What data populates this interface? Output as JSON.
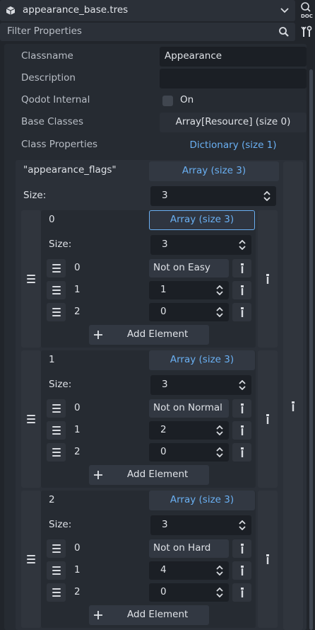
{
  "header": {
    "file_name": "appearance_base.tres",
    "doc_label": "DOC",
    "filter_placeholder": "Filter Properties"
  },
  "properties": [
    {
      "name": "Classname",
      "value": "Appearance"
    },
    {
      "name": "Description",
      "value": ""
    },
    {
      "name": "Qodot Internal",
      "value": "On"
    },
    {
      "name": "Base Classes",
      "value": "Array[Resource] (size 0)"
    },
    {
      "name": "Class Properties",
      "value": "Dictionary (size 1)"
    }
  ],
  "dict_entry": {
    "key": "\"appearance_flags\"",
    "value": "Array (size 3)",
    "size_label": "Size:",
    "size_value": "3"
  },
  "sub_arrays": [
    {
      "index": "0",
      "value": "Array (size 3)",
      "size_label": "Size:",
      "size_value": "3",
      "items": [
        {
          "index": "0",
          "value": "Not on Easy"
        },
        {
          "index": "1",
          "value": "1"
        },
        {
          "index": "2",
          "value": "0"
        }
      ],
      "add_label": "Add Element"
    },
    {
      "index": "1",
      "value": "Array (size 3)",
      "size_label": "Size:",
      "size_value": "3",
      "items": [
        {
          "index": "0",
          "value": "Not on Normal"
        },
        {
          "index": "1",
          "value": "2"
        },
        {
          "index": "2",
          "value": "0"
        }
      ],
      "add_label": "Add Element"
    },
    {
      "index": "2",
      "value": "Array (size 3)",
      "size_label": "Size:",
      "size_value": "3",
      "items": [
        {
          "index": "0",
          "value": "Not on Hard"
        },
        {
          "index": "1",
          "value": "4"
        },
        {
          "index": "2",
          "value": "0"
        }
      ],
      "add_label": "Add Element"
    }
  ],
  "icons": {
    "file": "resource-cube-icon",
    "dropdown": "chevron-down-icon",
    "search": "search-icon",
    "tools": "tools-icon",
    "drag": "drag-handle-icon",
    "type_menu": "kebab-menu-icon",
    "updown": "up-down-arrows-icon",
    "add": "plus-icon"
  },
  "colors": {
    "accent": "#6ab0f3",
    "panel": "#21252b",
    "field": "#1b1f25"
  }
}
